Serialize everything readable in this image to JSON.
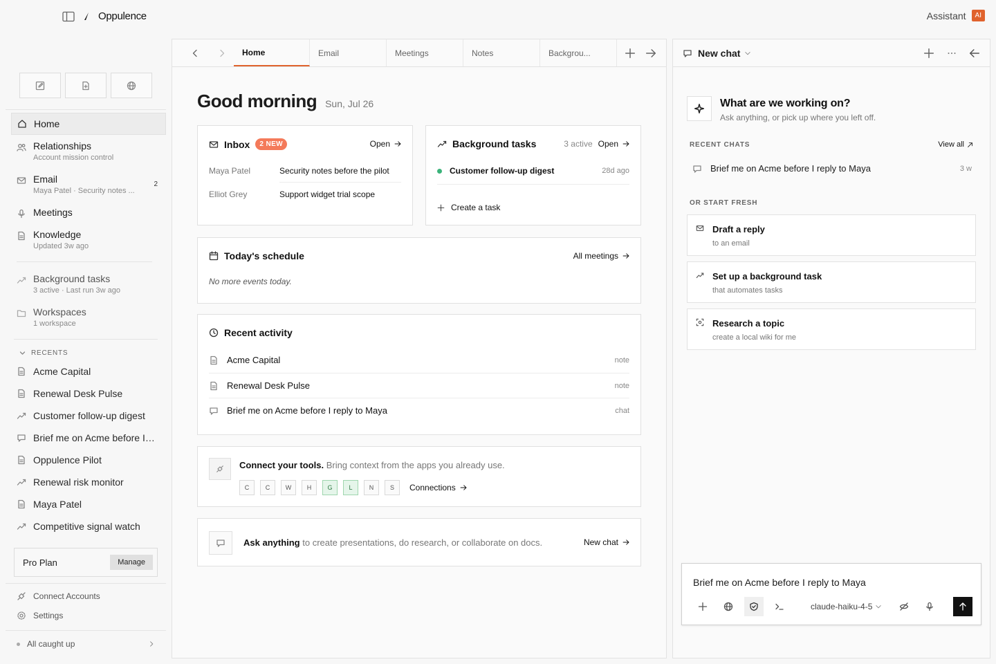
{
  "app": {
    "name": "Oppulence",
    "assistant_label": "Assistant",
    "ai_badge": "AI",
    "accent": "#e0622c"
  },
  "sidebar": {
    "nav": [
      {
        "label": "Home",
        "sub": ""
      },
      {
        "label": "Relationships",
        "sub": "Account mission control"
      },
      {
        "label": "Email",
        "sub": "Maya Patel · Security notes ...",
        "count": "2"
      },
      {
        "label": "Meetings",
        "sub": ""
      },
      {
        "label": "Knowledge",
        "sub": "Updated 3w ago"
      },
      {
        "label": "Background tasks",
        "sub": "3 active · Last run 3w ago"
      },
      {
        "label": "Workspaces",
        "sub": "1 workspace"
      }
    ],
    "recents_label": "RECENTS",
    "recents": [
      "Acme Capital",
      "Renewal Desk Pulse",
      "Customer follow-up digest",
      "Brief me on Acme before I reply to Maya",
      "Oppulence Pilot",
      "Renewal risk monitor",
      "Maya Patel",
      "Competitive signal watch"
    ],
    "plan": {
      "label": "Pro Plan",
      "manage": "Manage"
    },
    "footer": {
      "connect": "Connect Accounts",
      "settings": "Settings",
      "status": "All caught up"
    }
  },
  "tabs": [
    "Home",
    "Email",
    "Meetings",
    "Notes",
    "Backgrou..."
  ],
  "home": {
    "greeting": "Good morning",
    "date": "Sun, Jul 26",
    "inbox": {
      "title": "Inbox",
      "badge": "2 NEW",
      "open": "Open",
      "rows": [
        {
          "from": "Maya Patel",
          "subject": "Security notes before the pilot"
        },
        {
          "from": "Elliot Grey",
          "subject": "Support widget trial scope"
        }
      ]
    },
    "tasks": {
      "title": "Background tasks",
      "active": "3 active",
      "open": "Open",
      "item": "Customer follow-up digest",
      "ago": "28d ago",
      "create": "Create a task"
    },
    "schedule": {
      "title": "Today's schedule",
      "link": "All meetings",
      "empty": "No more events today."
    },
    "activity": {
      "title": "Recent activity",
      "items": [
        {
          "name": "Acme Capital",
          "kind": "note"
        },
        {
          "name": "Renewal Desk Pulse",
          "kind": "note"
        },
        {
          "name": "Brief me on Acme before I reply to Maya",
          "kind": "chat"
        }
      ]
    },
    "connect": {
      "title": "Connect your tools.",
      "desc": "Bring context from the apps you already use.",
      "tools": [
        "C",
        "C",
        "W",
        "H",
        "G",
        "L",
        "N",
        "S"
      ],
      "link": "Connections"
    },
    "ask": {
      "title": "Ask anything",
      "desc": "to create presentations, do research, or collaborate on docs.",
      "link": "New chat"
    }
  },
  "chat": {
    "header": "New chat",
    "hero_title": "What are we working on?",
    "hero_sub": "Ask anything, or pick up where you left off.",
    "recent_label": "RECENT CHATS",
    "view_all": "View all",
    "recent": [
      {
        "title": "Brief me on Acme before I reply to Maya",
        "age": "3 w"
      }
    ],
    "fresh_label": "OR START FRESH",
    "starters": [
      {
        "title": "Draft a reply",
        "sub": "to an email"
      },
      {
        "title": "Set up a background task",
        "sub": "that automates tasks"
      },
      {
        "title": "Research a topic",
        "sub": "create a local wiki for me"
      }
    ],
    "composer_text": "Brief me on Acme before I reply to Maya",
    "model": "claude-haiku-4-5"
  }
}
